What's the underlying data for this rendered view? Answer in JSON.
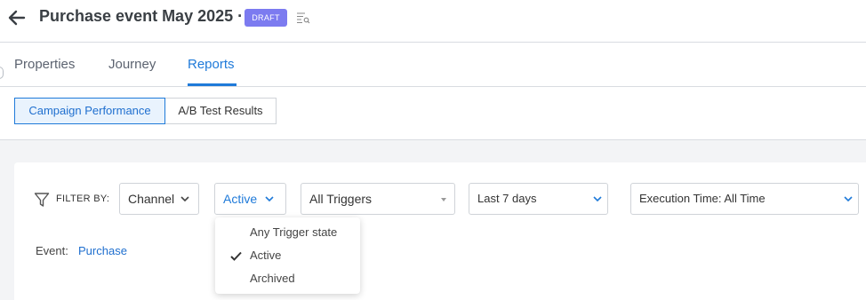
{
  "header": {
    "title": "Purchase event May 2025 ·",
    "status_badge": "DRAFT",
    "badge_color": "#7c7bf0"
  },
  "tabs": [
    {
      "label": "Properties"
    },
    {
      "label": "Journey"
    },
    {
      "label": "Reports"
    }
  ],
  "active_tab": "Reports",
  "report_views": [
    {
      "label": "Campaign Performance"
    },
    {
      "label": "A/B Test Results"
    }
  ],
  "active_report_view": "Campaign Performance",
  "filters": {
    "label": "FILTER BY:",
    "channel": "Channel",
    "state": "Active",
    "triggers": "All Triggers",
    "date_range": "Last 7 days",
    "execution_time": "Execution Time: All Time"
  },
  "event": {
    "label": "Event:",
    "value": "Purchase"
  },
  "state_menu": {
    "options": [
      "Any Trigger state",
      "Active",
      "Archived"
    ],
    "selected": "Active"
  },
  "colors": {
    "accent": "#1f7ad9",
    "background": "#f3f4f6"
  }
}
